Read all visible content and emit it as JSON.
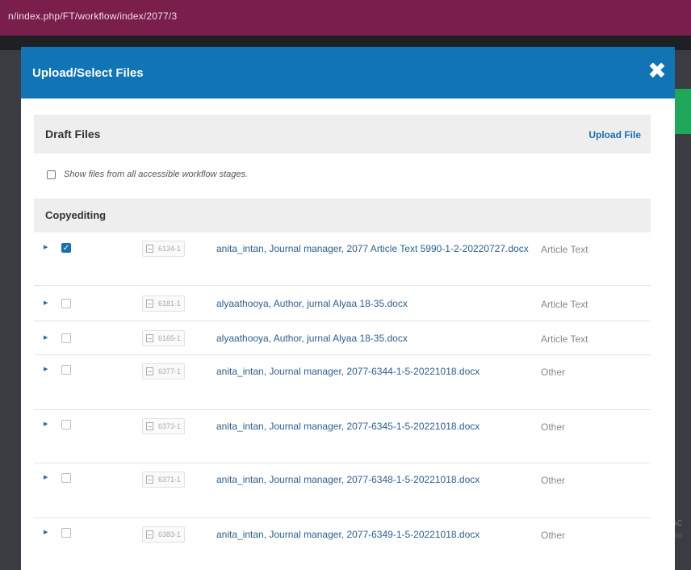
{
  "browser": {
    "url": "n/index.php/FT/workflow/index/2077/3"
  },
  "modal": {
    "title": "Upload/Select Files",
    "close_glyph": "✖"
  },
  "draft": {
    "title": "Draft Files",
    "upload_label": "Upload File"
  },
  "show_files": {
    "label": "Show files from all accessible workflow stages."
  },
  "stage": {
    "title": "Copyediting"
  },
  "files": [
    {
      "id": "6134-1",
      "name": "anita_intan, Journal manager, 2077 Article Text 5990-1-2-20220727.docx",
      "type": "Article Text",
      "checked": true
    },
    {
      "id": "6181-1",
      "name": "alyaathooya, Author, jurnal Alyaa 18-35.docx",
      "type": "Article Text",
      "checked": false
    },
    {
      "id": "6165-1",
      "name": "alyaathooya, Author, jurnal Alyaa 18-35.docx",
      "type": "Article Text",
      "checked": false
    },
    {
      "id": "6377-1",
      "name": "anita_intan, Journal manager, 2077-6344-1-5-20221018.docx",
      "type": "Other",
      "checked": false
    },
    {
      "id": "6373-1",
      "name": "anita_intan, Journal manager, 2077-6345-1-5-20221018.docx",
      "type": "Other",
      "checked": false
    },
    {
      "id": "6371-1",
      "name": "anita_intan, Journal manager, 2077-6348-1-5-20221018.docx",
      "type": "Other",
      "checked": false
    },
    {
      "id": "6383-1",
      "name": "anita_intan, Journal manager, 2077-6349-1-5-20221018.docx",
      "type": "Other",
      "checked": false
    }
  ],
  "background": {
    "watermark_line1": "Ac",
    "watermark_line2": "Go"
  },
  "colors": {
    "header_blue": "#1074b5",
    "browser_bar": "#7a1f4c",
    "link_blue": "#1a6fb0"
  }
}
